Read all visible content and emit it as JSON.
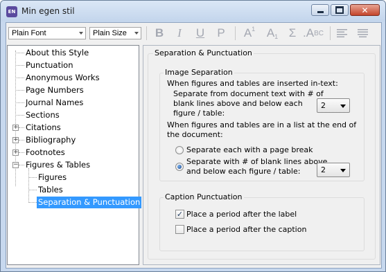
{
  "window": {
    "title": "Min egen stil",
    "app_icon_text": "EN",
    "controls": {
      "minimize": "minimize",
      "maximize": "maximize",
      "close": "✕"
    }
  },
  "toolbar": {
    "font_select": "Plain Font",
    "size_select": "Plain Size",
    "bold": "B",
    "italic": "I",
    "underline": "U",
    "plain": "P",
    "superscript_base": "A",
    "superscript_mark": "1",
    "subscript_base": "A",
    "subscript_mark": "1",
    "symbol": "Σ",
    "small_caps_dot": ".",
    "small_caps_a": "A",
    "small_caps_bc": "BC",
    "align_left": "align-left-icon",
    "justify": "justify-icon"
  },
  "tree": {
    "items": [
      {
        "label": "About this Style"
      },
      {
        "label": "Punctuation"
      },
      {
        "label": "Anonymous Works"
      },
      {
        "label": "Page Numbers"
      },
      {
        "label": "Journal Names"
      },
      {
        "label": "Sections"
      },
      {
        "label": "Citations"
      },
      {
        "label": "Bibliography"
      },
      {
        "label": "Footnotes"
      },
      {
        "label": "Figures & Tables"
      },
      {
        "label": "Figures"
      },
      {
        "label": "Tables"
      },
      {
        "label": "Separation & Punctuation"
      }
    ],
    "expander_plus": "+",
    "expander_minus": "−"
  },
  "panel": {
    "title": "Separation & Punctuation",
    "image_separation": {
      "title": "Image Separation",
      "intext_heading": "When figures and tables are inserted in-text:",
      "intext_label_1": "Separate from document text with # of",
      "intext_label_2": "blank lines above and below each",
      "intext_label_3": "figure / table:",
      "intext_value": "2",
      "list_heading_1": "When figures and tables are in a list at the end of",
      "list_heading_2": "the document:",
      "option_page_break": "Separate each with a page break",
      "option_blank_lines_1": "Separate with # of blank lines above",
      "option_blank_lines_2": "and below each figure / table:",
      "blank_lines_value": "2",
      "selected_option": "blank_lines"
    },
    "caption_punctuation": {
      "title": "Caption Punctuation",
      "period_after_label": "Place a period after the label",
      "period_after_label_checked": true,
      "period_after_caption": "Place a period after the caption",
      "period_after_caption_checked": false,
      "check_mark": "✓"
    }
  }
}
